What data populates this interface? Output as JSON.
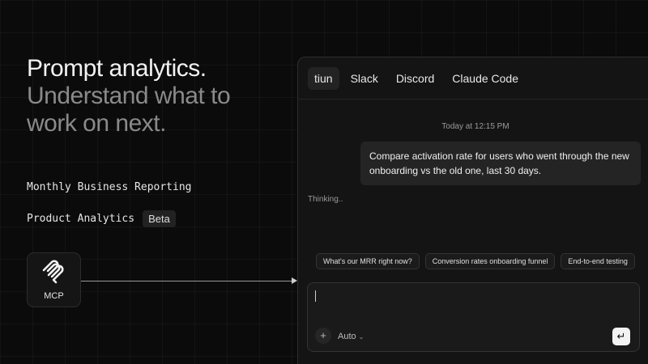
{
  "hero": {
    "line1": "Prompt analytics.",
    "line2a": "Understand what to",
    "line2b": "work on next."
  },
  "features": [
    {
      "label": "Monthly Business Reporting"
    },
    {
      "label": "Product Analytics",
      "badge": "Beta"
    }
  ],
  "mcp": {
    "label": "MCP",
    "icon": "mcp-logo-icon"
  },
  "tabs": [
    {
      "label": "tiun",
      "active": true
    },
    {
      "label": "Slack"
    },
    {
      "label": "Discord"
    },
    {
      "label": "Claude Code"
    }
  ],
  "chat": {
    "timestamp": "Today at 12:15 PM",
    "user_message": "Compare activation rate for users who went through the new onboarding vs the old one, last 30 days.",
    "status": "Thinking.."
  },
  "suggestions": [
    "What's our MRR right now?",
    "Conversion rates onboarding funnel",
    "End-to-end testing"
  ],
  "composer": {
    "value": "",
    "placeholder": "",
    "plus_icon": "plus-icon",
    "model_label": "Auto",
    "chevron_icon": "chevron-down-icon",
    "send_icon": "enter-icon"
  },
  "colors": {
    "background": "#0b0b0b",
    "panel": "#141414",
    "bubble": "#242424",
    "text_primary": "#f2f2f2",
    "text_muted": "#8a8a8a",
    "send_button": "#f2f2f2"
  }
}
